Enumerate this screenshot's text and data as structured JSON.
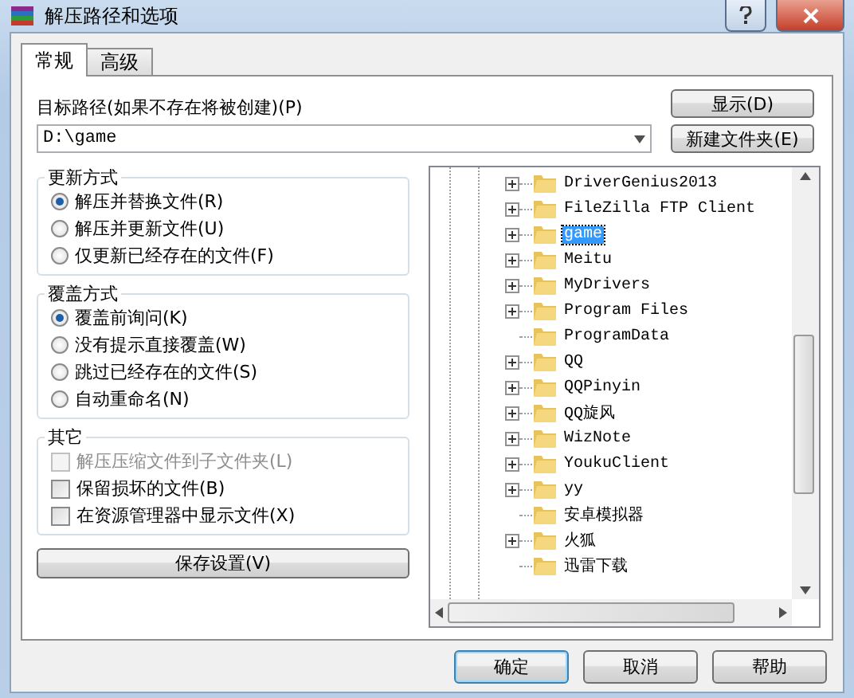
{
  "window": {
    "title": "解压路径和选项"
  },
  "tabs": [
    {
      "label": "常规",
      "selected": true
    },
    {
      "label": "高级",
      "selected": false
    }
  ],
  "path": {
    "label": "目标路径(如果不存在将被创建)(P)",
    "value": "D:\\game"
  },
  "side_buttons": [
    "显示(D)",
    "新建文件夹(E)"
  ],
  "groups": [
    {
      "title": "更新方式",
      "options": [
        {
          "label": "解压并替换文件(R)",
          "selected": true
        },
        {
          "label": "解压并更新文件(U)",
          "selected": false
        },
        {
          "label": "仅更新已经存在的文件(F)",
          "selected": false
        }
      ]
    },
    {
      "title": "覆盖方式",
      "options": [
        {
          "label": "覆盖前询问(K)",
          "selected": true
        },
        {
          "label": "没有提示直接覆盖(W)",
          "selected": false
        },
        {
          "label": "跳过已经存在的文件(S)",
          "selected": false
        },
        {
          "label": "自动重命名(N)",
          "selected": false
        }
      ]
    }
  ],
  "misc": {
    "title": "其它",
    "options": [
      {
        "label": "解压压缩文件到子文件夹(L)",
        "checked": false,
        "disabled": true
      },
      {
        "label": "保留损坏的文件(B)",
        "checked": false,
        "disabled": false
      },
      {
        "label": "在资源管理器中显示文件(X)",
        "checked": false,
        "disabled": false
      }
    ]
  },
  "save_button": "保存设置(V)",
  "tree": [
    {
      "label": "DriverGenius2013",
      "expandable": true,
      "selected": false
    },
    {
      "label": "FileZilla FTP Client",
      "expandable": true,
      "selected": false
    },
    {
      "label": "game",
      "expandable": true,
      "selected": true
    },
    {
      "label": "Meitu",
      "expandable": true,
      "selected": false
    },
    {
      "label": "MyDrivers",
      "expandable": true,
      "selected": false
    },
    {
      "label": "Program Files",
      "expandable": true,
      "selected": false
    },
    {
      "label": "ProgramData",
      "expandable": false,
      "selected": false
    },
    {
      "label": "QQ",
      "expandable": true,
      "selected": false
    },
    {
      "label": "QQPinyin",
      "expandable": true,
      "selected": false
    },
    {
      "label": "QQ旋风",
      "expandable": true,
      "selected": false
    },
    {
      "label": "WizNote",
      "expandable": true,
      "selected": false
    },
    {
      "label": "YoukuClient",
      "expandable": true,
      "selected": false
    },
    {
      "label": "yy",
      "expandable": true,
      "selected": false
    },
    {
      "label": "安卓模拟器",
      "expandable": false,
      "selected": false
    },
    {
      "label": "火狐",
      "expandable": true,
      "selected": false
    },
    {
      "label": "迅雷下载",
      "expandable": false,
      "selected": false
    }
  ],
  "footer_buttons": [
    {
      "label": "确定",
      "default": true
    },
    {
      "label": "取消",
      "default": false
    },
    {
      "label": "帮助",
      "default": false
    }
  ]
}
